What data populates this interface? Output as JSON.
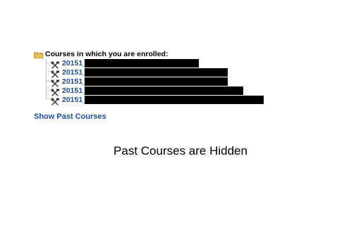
{
  "enrolled_panel": {
    "header": "Courses in which you are enrolled:",
    "courses": [
      {
        "label": "20151_"
      },
      {
        "label": "20151_"
      },
      {
        "label": "20151_"
      },
      {
        "label": "20151_"
      },
      {
        "label": "20151_"
      }
    ]
  },
  "show_past_link": "Show Past Courses",
  "caption": "Past Courses are Hidden",
  "icons": {
    "header": "folder-icon",
    "course": "tools-icon"
  },
  "colors": {
    "link": "#1f4e9e",
    "redaction": "#000000",
    "folder": "#e8c35a"
  }
}
